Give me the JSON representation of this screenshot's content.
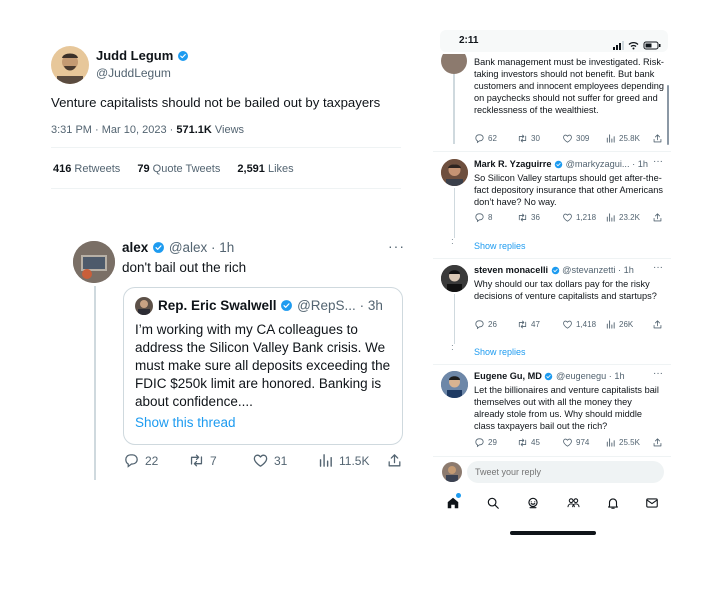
{
  "main_tweet": {
    "author_name": "Judd Legum",
    "author_handle": "@JuddLegum",
    "text": "Venture capitalists should not be bailed out by taxpayers",
    "time": "3:31 PM",
    "date": "Mar 10, 2023",
    "views_count": "571.1K",
    "views_label": "Views",
    "retweets_count": "416",
    "retweets_label": "Retweets",
    "quotes_count": "79",
    "quotes_label": "Quote Tweets",
    "likes_count": "2,591",
    "likes_label": "Likes"
  },
  "reply": {
    "author_name": "alex",
    "author_handle": "@alex",
    "age": "1h",
    "text": "don't bail out the rich",
    "quote": {
      "author_name": "Rep. Eric Swalwell",
      "author_handle": "@RepS...",
      "age": "3h",
      "text": "I’m working with my CA colleagues to address the Silicon Valley Bank crisis. We must make sure all deposits exceeding the FDIC $250k limit are honored. Banking is about confidence....",
      "link": "Show this thread"
    },
    "actions": {
      "replies": "22",
      "retweets": "7",
      "likes": "31",
      "views": "11.5K"
    }
  },
  "phone": {
    "status_time": "2:11",
    "replies": [
      {
        "text": "Bank management must be investigated. Risk-taking investors should not benefit. But bank customers and innocent employees depending on paychecks should not suffer for greed and recklessness of the wealthiest.",
        "actions": {
          "replies": "62",
          "retweets": "30",
          "likes": "309",
          "views": "25.8K"
        }
      },
      {
        "author_name": "Mark R. Yzaguirre",
        "author_handle": "@markyzagui...",
        "age": "1h",
        "text": "So Silicon Valley startups should get after-the-fact depository insurance that other Americans don’t have? No way.",
        "actions": {
          "replies": "8",
          "retweets": "36",
          "likes": "1,218",
          "views": "23.2K"
        },
        "show_replies": "Show replies"
      },
      {
        "author_name": "steven monacelli",
        "author_handle": "@stevanzetti",
        "age": "1h",
        "text": "Why should our tax dollars pay for the risky decisions of venture capitalists and startups?",
        "actions": {
          "replies": "26",
          "retweets": "47",
          "likes": "1,418",
          "views": "26K"
        },
        "show_replies": "Show replies"
      },
      {
        "author_name": "Eugene Gu, MD",
        "author_handle": "@eugenegu",
        "age": "1h",
        "text": "Let the billionaires and venture capitalists bail themselves out with all the money they already stole from us. Why should middle class taxpayers bail out the rich?",
        "actions": {
          "replies": "29",
          "retweets": "45",
          "likes": "974",
          "views": "25.5K"
        }
      }
    ],
    "reply_placeholder": "Tweet your reply"
  },
  "colors": {
    "accent": "#1d9bf0",
    "text": "#0f1419",
    "muted": "#536471",
    "border": "#cfd9de"
  },
  "icons": [
    "verified-icon",
    "reply-icon",
    "retweet-icon",
    "like-icon",
    "views-icon",
    "share-icon",
    "home-icon",
    "search-icon",
    "spaces-icon",
    "communities-icon",
    "notifications-icon",
    "messages-icon"
  ]
}
